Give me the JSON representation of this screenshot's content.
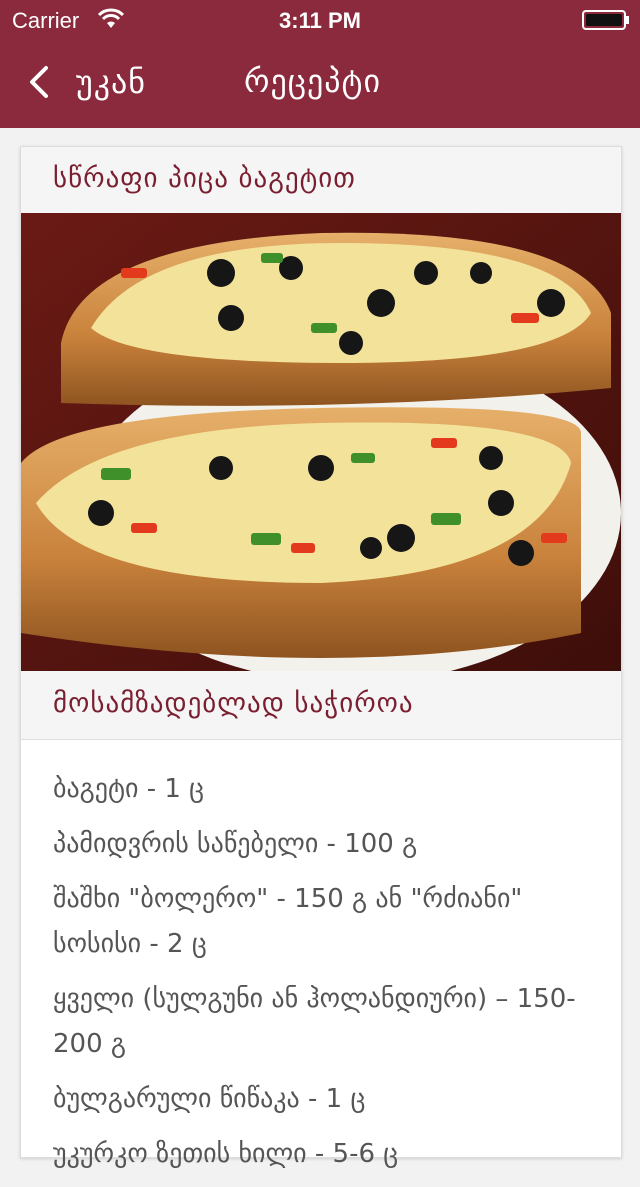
{
  "status_bar": {
    "carrier": "Carrier",
    "time": "3:11 PM"
  },
  "nav": {
    "back_label": "უკან",
    "title": "რეცეპტი"
  },
  "recipe": {
    "title": "სწრაფი პიცა ბაგეტით",
    "photo_icon": "pizza-baguette-photo"
  },
  "ingredients_section": {
    "heading": "მოსამზადებლად საჭიროა",
    "items": [
      "ბაგეტი - 1 ც",
      "პამიდვრის საწებელი - 100 გ",
      "შაშხი \"ბოლერო\" - 150 გ ან \"რძიანი\" სოსისი - 2 ც",
      "ყველი (სულგუნი ან ჰოლანდიური) – 150-200 გ",
      "ბულგარული წიწაკა - 1 ც",
      "უკურკო ზეთის ხილი - 5-6 ც"
    ]
  },
  "colors": {
    "brand": "#8a2a3c",
    "heading_text": "#7a1f30",
    "body_text": "#555555"
  }
}
